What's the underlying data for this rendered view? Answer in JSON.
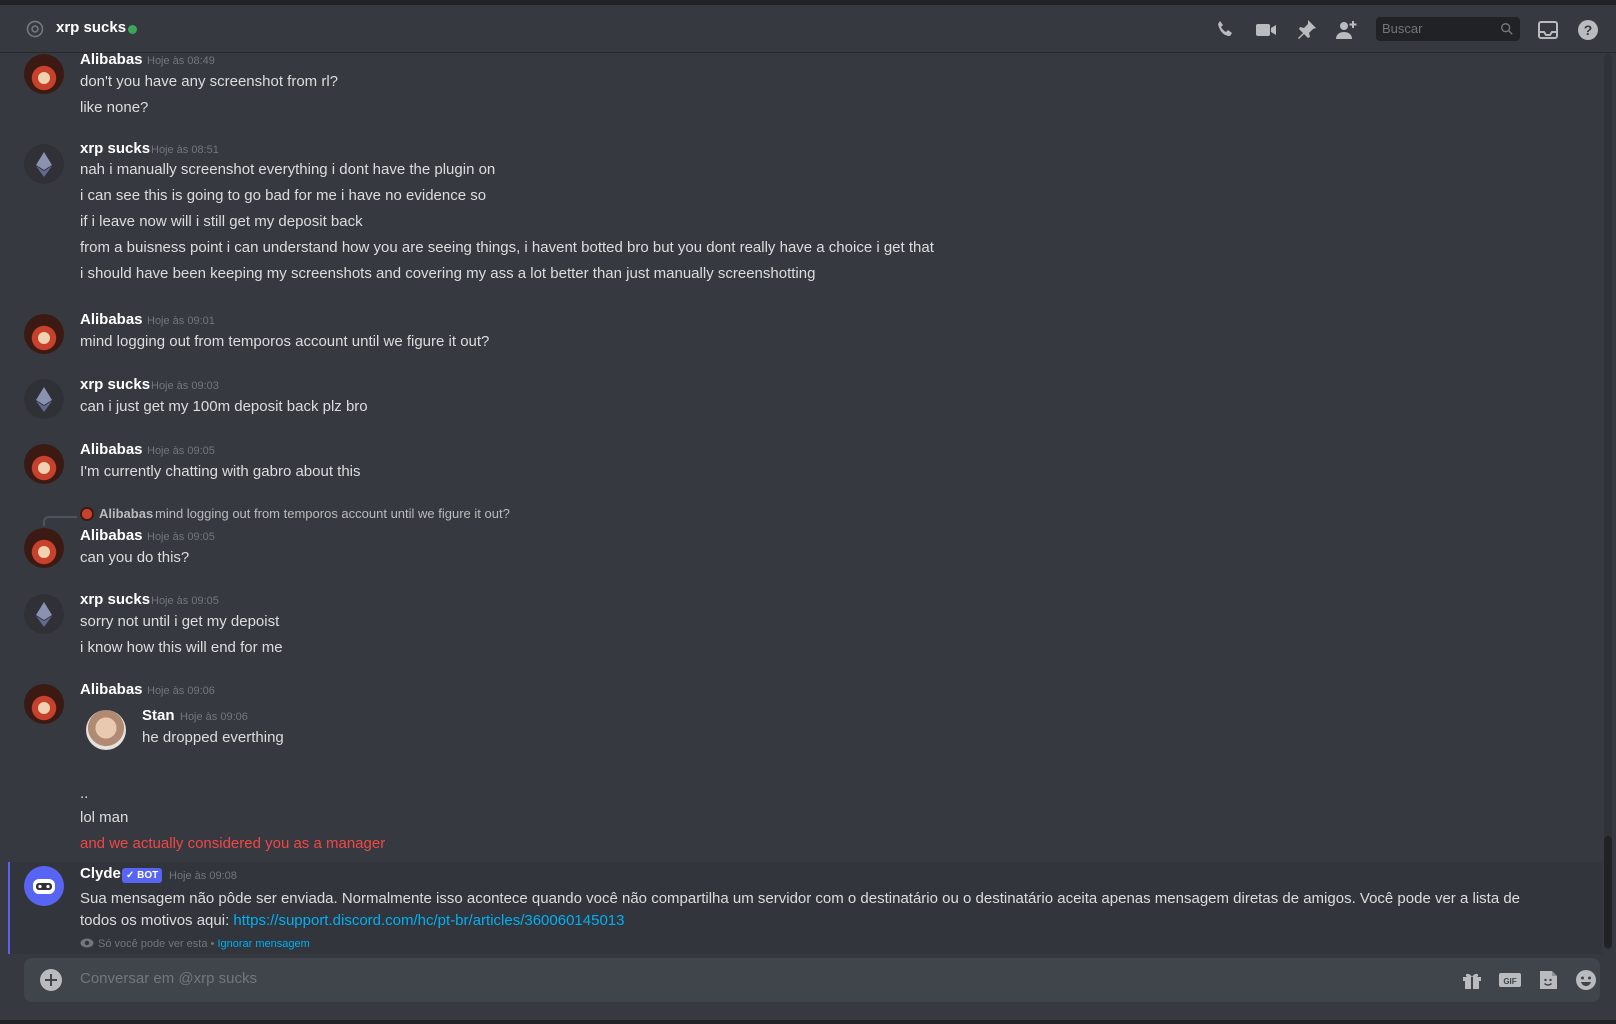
{
  "header": {
    "title": "xrp sucks",
    "search_placeholder": "Buscar",
    "icons": [
      "at-icon",
      "call-icon",
      "video-icon",
      "pin-icon",
      "add-friend-icon",
      "search-icon",
      "inbox-icon",
      "help-icon"
    ]
  },
  "messages": [
    {
      "author": "Alibabas",
      "time": "Hoje às 08:49",
      "lines": [
        "don't you have any screenshot from rl?",
        "like none?"
      ]
    },
    {
      "author": "xrp sucks",
      "time": "Hoje às 08:51",
      "lines": [
        "nah i manually screenshot everything i dont have the plugin on",
        "i can see this is going to go bad for me i have no evidence so",
        "if i leave now will i still get my deposit back",
        "from a buisness point i can understand how you are seeing things, i havent botted bro but you dont really have a choice i get that",
        "i should have been keeping my screenshots and covering my ass a lot better than just manually screenshotting"
      ]
    },
    {
      "author": "Alibabas",
      "time": "Hoje às 09:01",
      "lines": [
        "mind logging out from temporos account until we figure it out?"
      ]
    },
    {
      "author": "xrp sucks",
      "time": "Hoje às 09:03",
      "lines": [
        "can i just get my 100m deposit back plz bro"
      ]
    },
    {
      "author": "Alibabas",
      "time": "Hoje às 09:05",
      "lines": [
        "I'm currently chatting with gabro about this"
      ]
    },
    {
      "author": "Alibabas",
      "time": "Hoje às 09:05",
      "reply": {
        "author": "Alibabas",
        "text": "mind logging out from temporos account until we figure it out?"
      },
      "lines": [
        "can you do this?"
      ]
    },
    {
      "author": "xrp sucks",
      "time": "Hoje às 09:05",
      "lines": [
        "sorry not until i get my depoist",
        "i know how this will end for me"
      ]
    },
    {
      "author": "Alibabas",
      "time": "Hoje às 09:06",
      "quoted": {
        "author": "Stan",
        "time": "Hoje às 09:06",
        "text": "he dropped everthing"
      },
      "lines": [
        "..",
        "lol man",
        "and we actually considered you as a manager"
      ]
    }
  ],
  "clyde": {
    "author": "Clyde",
    "badge": "✓ BOT",
    "time": "Hoje às 09:08",
    "text": "Sua mensagem não pôde ser enviada. Normalmente isso acontece quando você não compartilha um servidor com o destinatário ou o destinatário aceita apenas mensagem diretas de amigos. Você pode ver a lista de todos os motivos aqui: ",
    "link": "https://support.discord.com/hc/pt-br/articles/360060145013",
    "ephemeral_note": "Só você pode ver esta •",
    "dismiss_label": "Ignorar mensagem"
  },
  "composer": {
    "placeholder": "Conversar em @xrp sucks",
    "icons": [
      "gift-icon",
      "gif-icon",
      "sticker-icon",
      "emoji-icon"
    ]
  }
}
